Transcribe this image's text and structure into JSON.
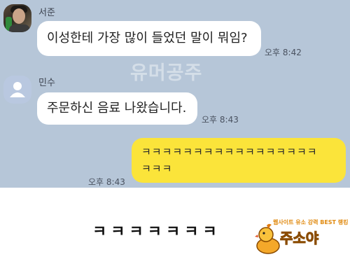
{
  "watermark": "유머공주",
  "messages": [
    {
      "sender": "서준",
      "text": "이성한테 가장 많이 들었던 말이 뭐임?",
      "time": "오후 8:42"
    },
    {
      "sender": "민수",
      "text": "주문하신 음료 나왔습니다.",
      "time": "오후 8:43"
    },
    {
      "sender": "",
      "line1": "ㅋㅋㅋㅋㅋㅋㅋㅋㅋㅋㅋㅋㅋㅋㅋㅋㅋ",
      "line2": "ㅋㅋㅋ",
      "time": "오후 8:43"
    }
  ],
  "caption": "ㅋㅋㅋㅋㅋㅋㅋ",
  "logo": {
    "tagline": "웹사이트 유소 강력 BEST 랭킹",
    "name": "주소야"
  },
  "colors": {
    "chat_bg": "#b6c6d8",
    "my_bubble": "#fbe43a",
    "their_bubble": "#ffffff"
  },
  "icons": {
    "profile_photo": "avatar-photo",
    "default_profile": "person-icon",
    "logo_mascot": "duck-icon"
  }
}
